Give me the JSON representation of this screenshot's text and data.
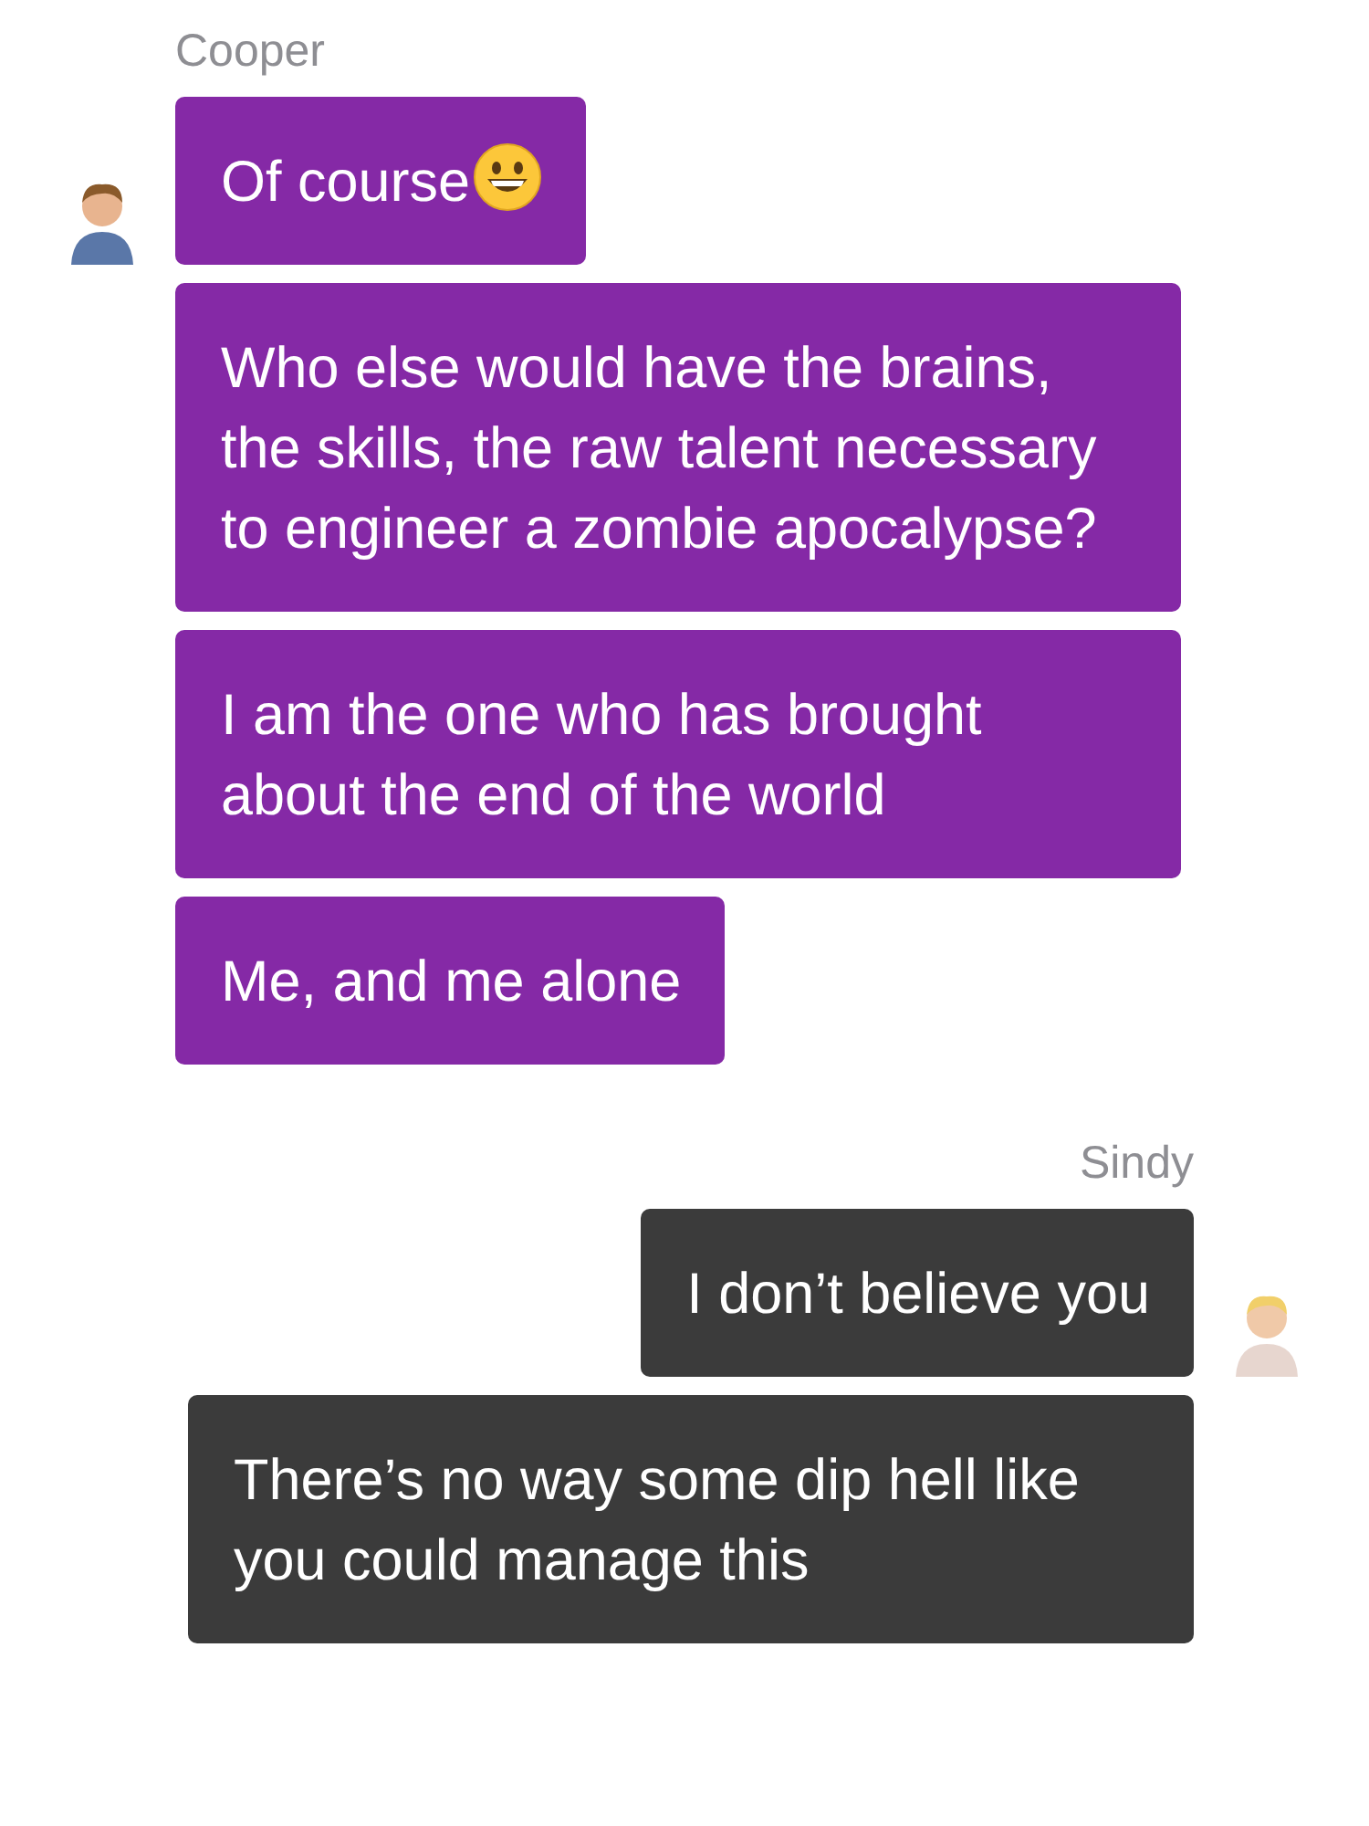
{
  "conversation": [
    {
      "sender": "Cooper",
      "kind": "incoming",
      "messages": [
        {
          "text": "Of course",
          "kind": "text_emoji"
        },
        {
          "text": "Who else would have the brains, the skills, the raw talent necessary to engineer a zombie apocalypse?",
          "kind": "text"
        },
        {
          "text": "I am the one who has brought about the end of the world",
          "kind": "text"
        },
        {
          "text": "Me, and me alone",
          "kind": "text"
        }
      ]
    },
    {
      "sender": "Sindy",
      "kind": "outgoing",
      "messages": [
        {
          "text": "I don’t believe you",
          "kind": "text"
        },
        {
          "text": "There’s no way some dip hell like you could manage this",
          "kind": "text"
        }
      ]
    }
  ]
}
